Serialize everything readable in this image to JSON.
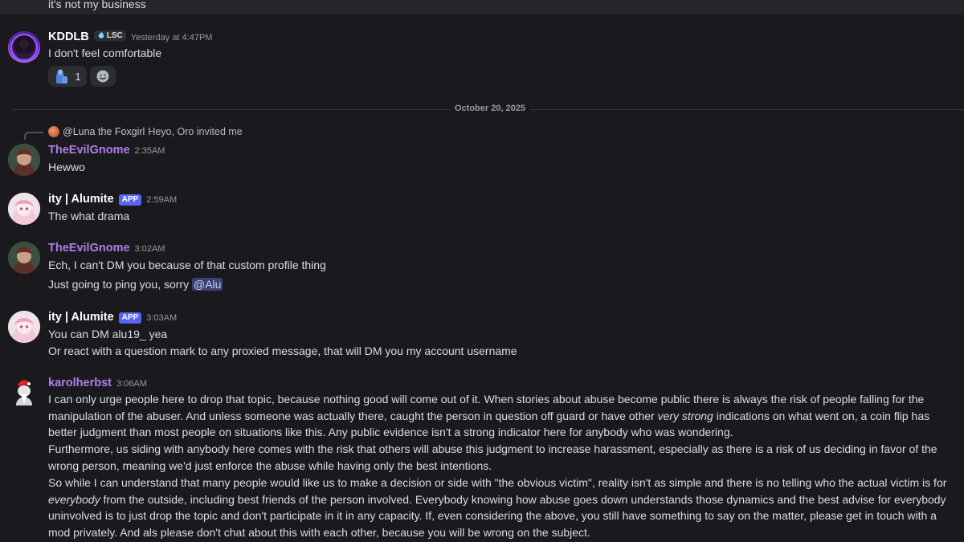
{
  "top_message": {
    "text": "it's not my business"
  },
  "divider": {
    "label": "October 20, 2025"
  },
  "messages": [
    {
      "username": "KDDLB",
      "name_color": "#ffffff",
      "tag": "LSC",
      "timestamp": "Yesterday at 4:47PM",
      "lines": [
        "I don't feel comfortable"
      ],
      "reaction_count": "1"
    },
    {
      "reply_to": "@Luna the Foxgirl",
      "reply_text": "Heyo, Oro invited me",
      "username": "TheEvilGnome",
      "name_color": "#b07ee8",
      "timestamp": "2:35AM",
      "lines": [
        "Hewwo"
      ]
    },
    {
      "username": "ity | Alumite",
      "name_color": "#ffffff",
      "badge": "APP",
      "timestamp": "2:59AM",
      "lines": [
        "The what drama"
      ]
    },
    {
      "username": "TheEvilGnome",
      "name_color": "#b07ee8",
      "timestamp": "3:02AM",
      "lines": [
        "Ech, I can't DM you because of that custom profile thing",
        "Just going to ping you, sorry"
      ],
      "mention": "@Alu"
    },
    {
      "username": "ity | Alumite",
      "name_color": "#ffffff",
      "badge": "APP",
      "timestamp": "3:03AM",
      "lines": [
        "You can DM alu19_ yea",
        "Or react with a question mark to any proxied message, that will DM you my account username"
      ]
    },
    {
      "username": "karolherbst",
      "name_color": "#b07ee8",
      "timestamp": "3:06AM",
      "p1_a": "I can only urge people here to drop that topic, because nothing good will come out of it. When stories about abuse become public there is always the risk of people falling for the manipulation of the abuser. And unless someone was actually there, caught the person in question off guard or have other ",
      "p1_em": "very strong",
      "p1_b": " indications on what went on, a coin flip has better judgment than most people on situations like this. Any public evidence isn't a strong indicator here for anybody who was wondering.",
      "p2": "Furthermore, us siding with anybody here comes with the risk that others will abuse this judgment to increase harassment, especially as there is a risk of us deciding in favor of the wrong person, meaning we'd just enforce the abuse while having only the best intentions.",
      "p3_a": "So while I can understand that many people would like us to make a decision or side with \"the obvious victim\", reality isn't as simple and there is no telling who the actual victim is for ",
      "p3_em": "everybody",
      "p3_b": " from the outside, including best friends of the person involved. Everybody knowing how abuse goes down understands those dynamics and the best advise for everybody uninvolved is to just drop the topic and don't participate in it in any capacity. If, even considering the above, you still have something to say on the matter, please get in touch with a mod privately. And als please don't chat about this with each other, because you will be wrong on the subject."
    }
  ],
  "colors": {
    "background": "#1a1a1e",
    "accent": "#5865f2",
    "gnome_name": "#b07ee8"
  }
}
